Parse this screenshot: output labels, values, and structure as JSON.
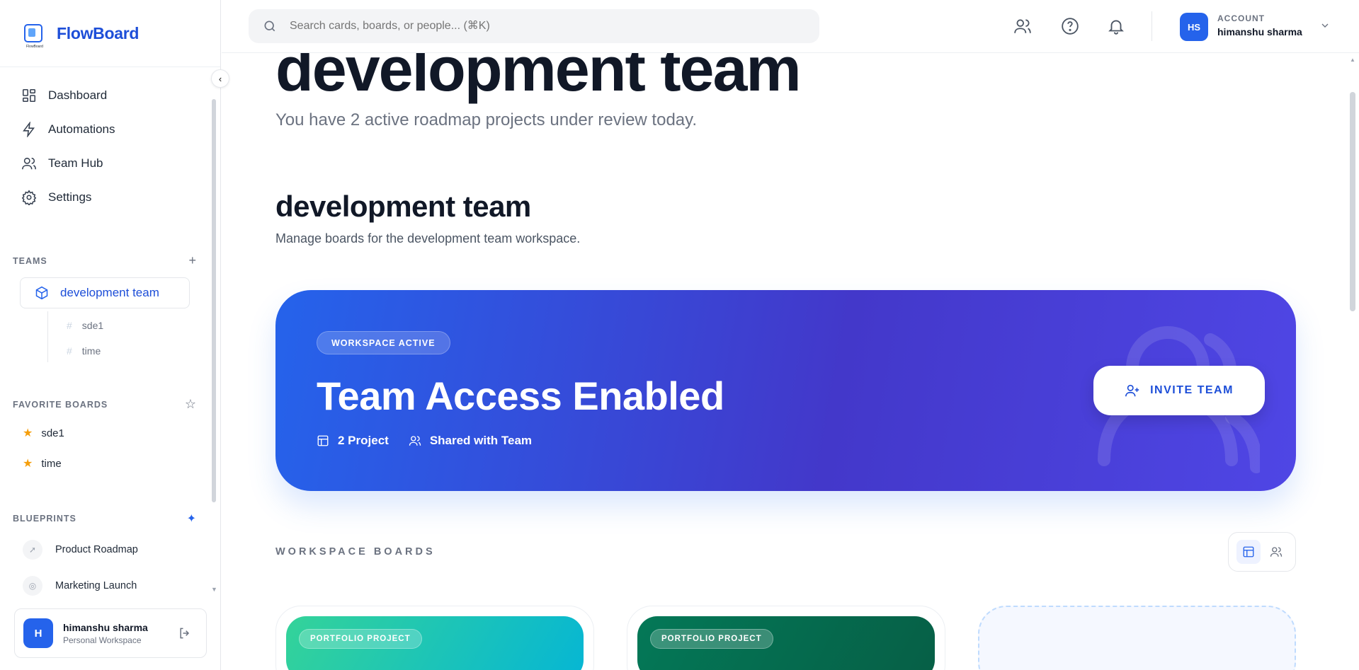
{
  "brand": {
    "name": "FlowBoard",
    "logo_text": "FlowBoard"
  },
  "sidebar": {
    "nav": [
      {
        "label": "Dashboard",
        "icon": "grid-icon"
      },
      {
        "label": "Automations",
        "icon": "bolt-icon"
      },
      {
        "label": "Team Hub",
        "icon": "users-icon"
      },
      {
        "label": "Settings",
        "icon": "gear-icon"
      }
    ],
    "teams_heading": "TEAMS",
    "teams_add": "+",
    "active_team": "development team",
    "team_boards": [
      "sde1",
      "time"
    ],
    "favorites_heading": "FAVORITE BOARDS",
    "favorites": [
      "sde1",
      "time"
    ],
    "blueprints_heading": "BLUEPRINTS",
    "blueprints": [
      "Product Roadmap",
      "Marketing Launch"
    ],
    "user": {
      "initial": "H",
      "name": "himanshu sharma",
      "workspace": "Personal Workspace"
    }
  },
  "topbar": {
    "search_placeholder": "Search cards, boards, or people... (⌘K)",
    "account_label": "ACCOUNT",
    "account_initials": "HS",
    "account_name": "himanshu sharma"
  },
  "main": {
    "title": "development team",
    "subtitle": "You have 2 active roadmap projects under review today.",
    "section_title": "development team",
    "section_subtitle": "Manage boards for the development team workspace.",
    "hero": {
      "badge": "WORKSPACE ACTIVE",
      "title": "Team Access Enabled",
      "projects": "2 Project",
      "shared": "Shared with Team",
      "invite_label": "INVITE TEAM"
    },
    "boards_heading": "WORKSPACE BOARDS",
    "boards": [
      {
        "badge": "PORTFOLIO PROJECT",
        "color_from": "#34d399",
        "color_to": "#06b6d4"
      },
      {
        "badge": "PORTFOLIO PROJECT",
        "color_from": "#047857",
        "color_to": "#065f46"
      }
    ]
  },
  "colors": {
    "accent": "#2563eb",
    "hero_from": "#2563eb",
    "hero_to": "#4f46e5",
    "star": "#f59e0b"
  }
}
